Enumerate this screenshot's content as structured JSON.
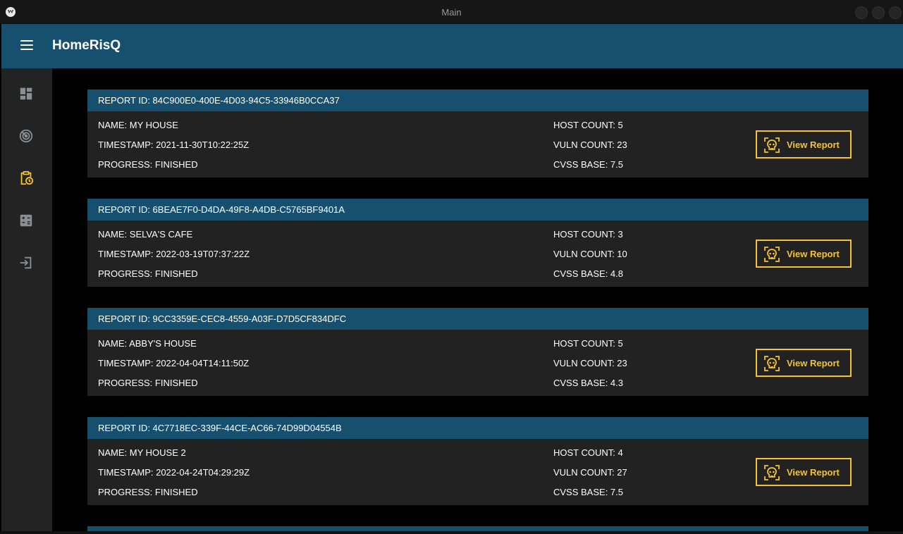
{
  "window": {
    "title": "Main"
  },
  "appbar": {
    "title": "HomeRisQ"
  },
  "sidebar": {
    "items": [
      {
        "icon": "dashboard-icon",
        "active": false
      },
      {
        "icon": "radar-icon",
        "active": false
      },
      {
        "icon": "clipboard-clock-icon",
        "active": true
      },
      {
        "icon": "calculator-icon",
        "active": false
      },
      {
        "icon": "logout-icon",
        "active": false
      }
    ]
  },
  "colors": {
    "accent": "#f5c234",
    "header": "#17506f",
    "card": "#222222",
    "sidebar": "#232323"
  },
  "reports": [
    {
      "id_text": "REPORT ID: 84C900E0-400E-4D03-94C5-33946B0CCA37",
      "name_text": "NAME: MY HOUSE",
      "timestamp_text": "TIMESTAMP: 2021-11-30T10:22:25Z",
      "progress_text": "PROGRESS: FINISHED",
      "host_text": "HOST COUNT: 5",
      "vuln_text": "VULN COUNT: 23",
      "cvss_text": "CVSS BASE: 7.5",
      "button_label": "View Report"
    },
    {
      "id_text": "REPORT ID: 6BEAE7F0-D4DA-49F8-A4DB-C5765BF9401A",
      "name_text": "NAME: SELVA'S CAFE",
      "timestamp_text": "TIMESTAMP: 2022-03-19T07:37:22Z",
      "progress_text": "PROGRESS: FINISHED",
      "host_text": "HOST COUNT: 3",
      "vuln_text": "VULN COUNT: 10",
      "cvss_text": "CVSS BASE: 4.8",
      "button_label": "View Report"
    },
    {
      "id_text": "REPORT ID: 9CC3359E-CEC8-4559-A03F-D7D5CF834DFC",
      "name_text": "NAME: ABBY'S HOUSE",
      "timestamp_text": "TIMESTAMP: 2022-04-04T14:11:50Z",
      "progress_text": "PROGRESS: FINISHED",
      "host_text": "HOST COUNT: 5",
      "vuln_text": "VULN COUNT: 23",
      "cvss_text": "CVSS BASE: 4.3",
      "button_label": "View Report"
    },
    {
      "id_text": "REPORT ID: 4C7718EC-339F-44CE-AC66-74D99D04554B",
      "name_text": "NAME: MY HOUSE 2",
      "timestamp_text": "TIMESTAMP: 2022-04-24T04:29:29Z",
      "progress_text": "PROGRESS: FINISHED",
      "host_text": "HOST COUNT: 4",
      "vuln_text": "VULN COUNT: 27",
      "cvss_text": "CVSS BASE: 7.5",
      "button_label": "View Report"
    }
  ]
}
